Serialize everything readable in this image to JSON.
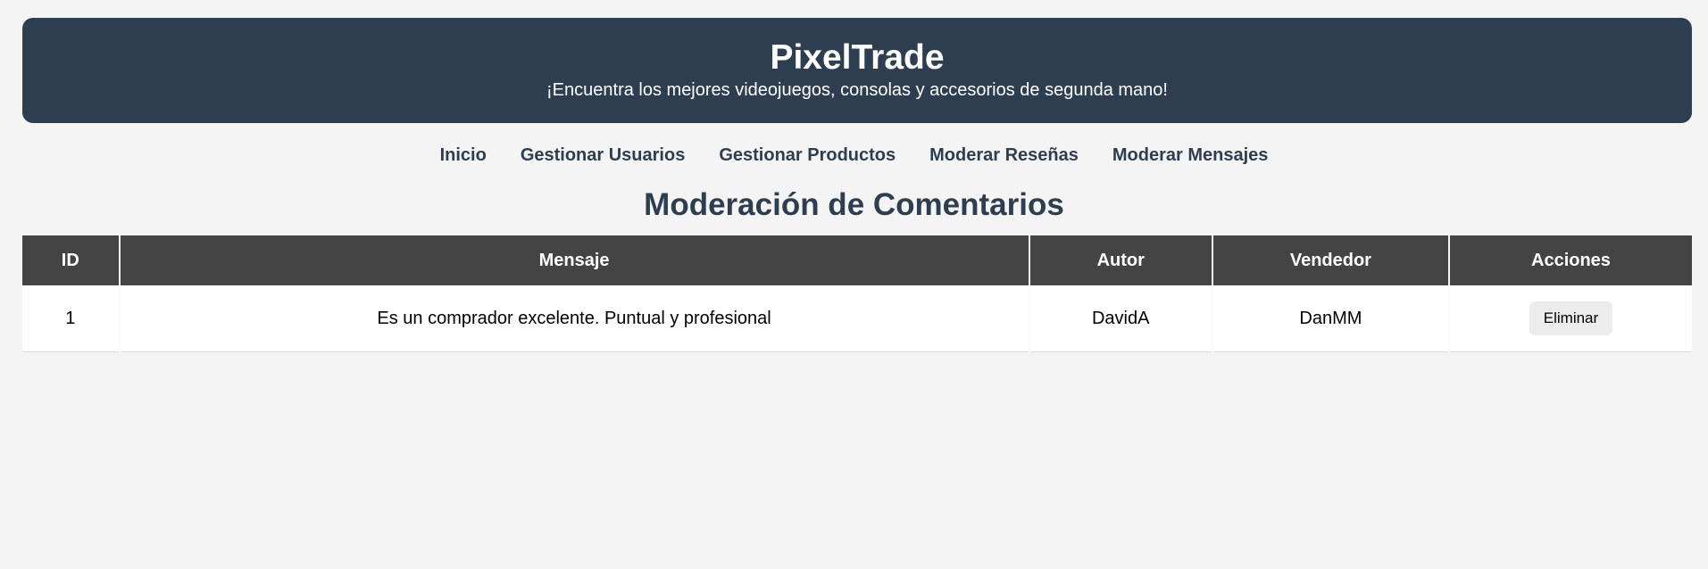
{
  "header": {
    "title": "PixelTrade",
    "subtitle": "¡Encuentra los mejores videojuegos, consolas y accesorios de segunda mano!"
  },
  "nav": {
    "items": [
      {
        "label": "Inicio"
      },
      {
        "label": "Gestionar Usuarios"
      },
      {
        "label": "Gestionar Productos"
      },
      {
        "label": "Moderar Reseñas"
      },
      {
        "label": "Moderar Mensajes"
      }
    ]
  },
  "main": {
    "title": "Moderación de Comentarios",
    "table": {
      "headers": [
        "ID",
        "Mensaje",
        "Autor",
        "Vendedor",
        "Acciones"
      ],
      "rows": [
        {
          "id": "1",
          "message": "Es un comprador excelente. Puntual y profesional",
          "author": "DavidA",
          "seller": "DanMM",
          "action_label": "Eliminar"
        }
      ]
    }
  },
  "colors": {
    "header_bg": "#2d3e50",
    "table_header_bg": "#444444",
    "page_bg": "#f4f4f4"
  }
}
